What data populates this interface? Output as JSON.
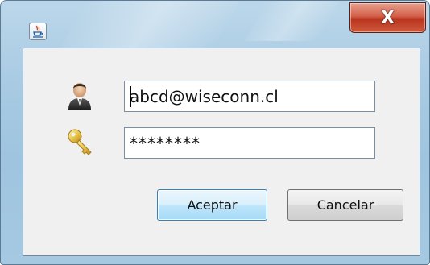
{
  "window": {
    "close_label": "X",
    "title_icon": "java-cup-icon"
  },
  "login": {
    "user_icon": "user-icon",
    "key_icon": "key-icon",
    "email_value": "abcd@wiseconn.cl",
    "password_value": "********"
  },
  "buttons": {
    "accept_label": "Aceptar",
    "cancel_label": "Cancelar"
  },
  "colors": {
    "frame": "#a9cbe3",
    "close_button": "#c8462c",
    "accept_border": "#3c7fb1",
    "panel": "#f0f0f0"
  }
}
